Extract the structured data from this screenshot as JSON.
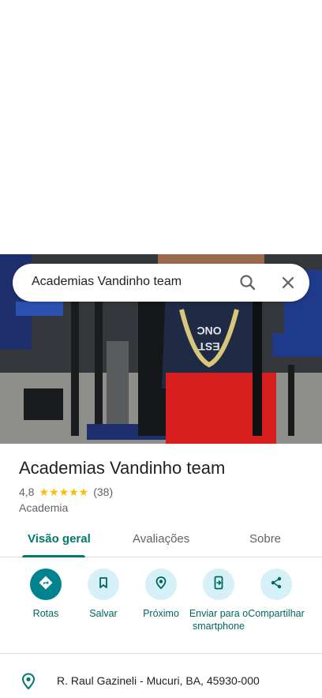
{
  "search": {
    "query": "Academias Vandinho team"
  },
  "place": {
    "title": "Academias Vandinho team",
    "rating": "4,8",
    "stars": "★★★★★",
    "review_count": "(38)",
    "category": "Academia"
  },
  "tabs": [
    {
      "label": "Visão geral",
      "active": true
    },
    {
      "label": "Avaliações",
      "active": false
    },
    {
      "label": "Sobre",
      "active": false
    }
  ],
  "actions": [
    {
      "label": "Rotas",
      "icon": "directions-icon"
    },
    {
      "label": "Salvar",
      "icon": "bookmark-icon"
    },
    {
      "label": "Próximo",
      "icon": "nearby-icon"
    },
    {
      "label": "Enviar para o smartphone",
      "icon": "send-to-phone-icon"
    },
    {
      "label": "Compartilhar",
      "icon": "share-icon"
    }
  ],
  "address": {
    "text": "R. Raul Gazineli - Mucuri, BA, 45930-000"
  },
  "photo": {
    "shirt_text": "ONCE\nEST"
  },
  "colors": {
    "accent": "#00796b",
    "action_bg": "#d5f1f7",
    "star": "#fbbc04"
  }
}
